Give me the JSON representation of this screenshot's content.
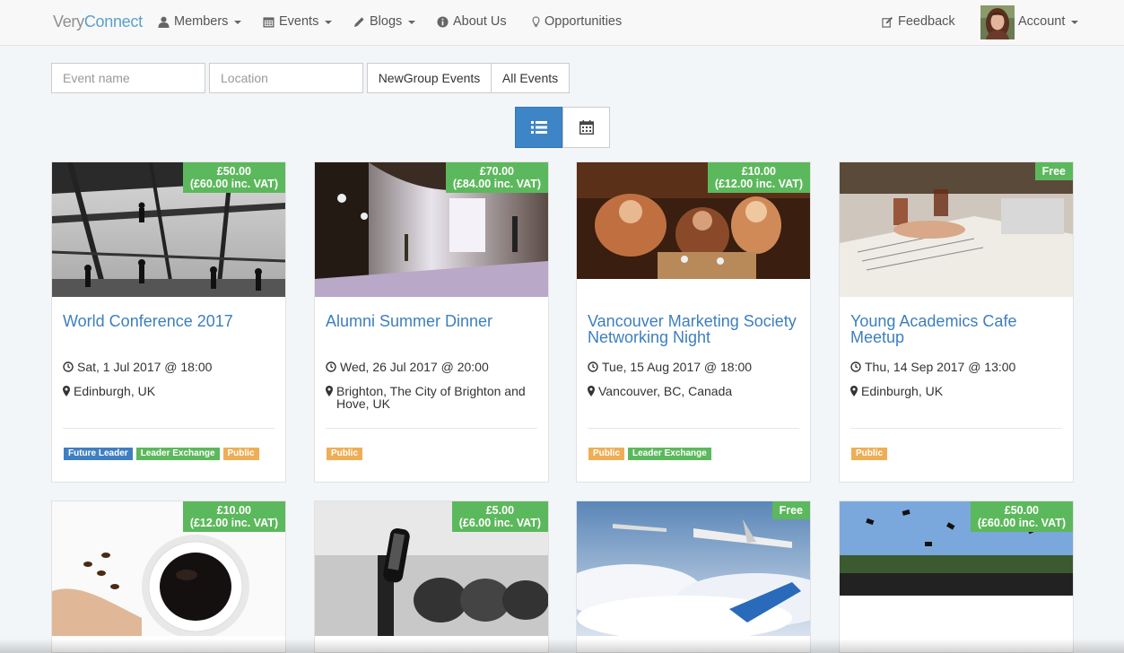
{
  "navbar": {
    "brand_part1": "Very",
    "brand_part2": "Connect",
    "members": "Members",
    "events": "Events",
    "blogs": "Blogs",
    "about": "About Us",
    "opportunities": "Opportunities",
    "feedback": "Feedback",
    "account": "Account"
  },
  "filters": {
    "event_name_placeholder": "Event name",
    "location_placeholder": "Location",
    "newgroup_label": "NewGroup Events",
    "all_label": "All Events"
  },
  "icons": {
    "list_view": "list-icon",
    "calendar_view": "calendar-icon",
    "time": "clock-icon",
    "location": "map-marker-icon"
  },
  "colors": {
    "brand_accent": "#5aa0cf",
    "link": "#3d7fbd",
    "price_badge": "#5cb85c",
    "tag_blue": "#3f7fc1",
    "tag_green": "#5cb85c",
    "tag_orange": "#eeae55",
    "active_view": "#3d85c6"
  },
  "events": [
    {
      "price_line1": "£50.00",
      "price_line2": "(£60.00 inc. VAT)",
      "title": "World Conference 2017",
      "date": "Sat, 1 Jul 2017 @ 18:00",
      "location": "Edinburgh, UK",
      "tags": [
        {
          "label": "Future Leader",
          "color": "blue"
        },
        {
          "label": "Leader Exchange",
          "color": "green"
        },
        {
          "label": "Public",
          "color": "orange"
        }
      ]
    },
    {
      "price_line1": "£70.00",
      "price_line2": "(£84.00 inc. VAT)",
      "title": "Alumni Summer Dinner",
      "date": "Wed, 26 Jul 2017 @ 20:00",
      "location": "Brighton, The City of Brighton and Hove, UK",
      "tags": [
        {
          "label": "Public",
          "color": "orange"
        }
      ]
    },
    {
      "price_line1": "£10.00",
      "price_line2": "(£12.00 inc. VAT)",
      "title": "Vancouver Marketing Society Networking Night",
      "date": "Tue, 15 Aug 2017 @ 18:00",
      "location": "Vancouver, BC, Canada",
      "tags": [
        {
          "label": "Public",
          "color": "orange"
        },
        {
          "label": "Leader Exchange",
          "color": "green"
        }
      ]
    },
    {
      "price_line1": "Free",
      "price_line2": "",
      "title": "Young Academics Cafe Meetup",
      "date": "Thu, 14 Sep 2017 @ 13:00",
      "location": "Edinburgh, UK",
      "tags": [
        {
          "label": "Public",
          "color": "orange"
        }
      ]
    },
    {
      "price_line1": "£10.00",
      "price_line2": "(£12.00 inc. VAT)"
    },
    {
      "price_line1": "£5.00",
      "price_line2": "(£6.00 inc. VAT)"
    },
    {
      "price_line1": "Free",
      "price_line2": ""
    },
    {
      "price_line1": "£50.00",
      "price_line2": "(£60.00 inc. VAT)"
    }
  ]
}
